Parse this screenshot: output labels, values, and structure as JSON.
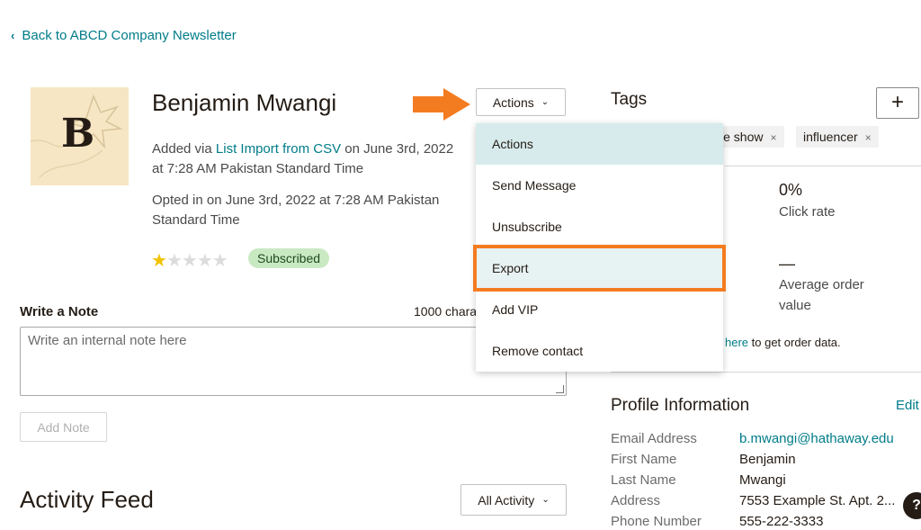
{
  "back_link": "Back to ABCD Company Newsletter",
  "avatar_letter": "B",
  "contact": {
    "name": "Benjamin Mwangi",
    "added_prefix": "Added via ",
    "added_link": "List Import from CSV",
    "added_suffix": " on June 3rd, 2022 at 7:28 AM Pakistan Standard Time",
    "opted_in": "Opted in on June 3rd, 2022 at 7:28 AM Pakistan Standard Time",
    "rating": 1,
    "rating_max": 5,
    "status": "Subscribed"
  },
  "actions_button": "Actions",
  "actions_menu": [
    "Actions",
    "Send Message",
    "Unsubscribe",
    "Export",
    "Add VIP",
    "Remove contact"
  ],
  "note": {
    "label": "Write a Note",
    "counter": "1000 characters",
    "placeholder": "Write an internal note here",
    "add_button": "Add Note"
  },
  "feed": {
    "title": "Activity Feed",
    "filter": "All Activity"
  },
  "tags": {
    "title": "Tags",
    "add": "+",
    "items": [
      "trade show",
      "influencer"
    ]
  },
  "stats": {
    "click_rate_value": "0%",
    "click_rate_label": "Click rate",
    "aov_value": "—",
    "aov_label": "Average order value",
    "orders_link": "here",
    "orders_text": " to get order data."
  },
  "profile": {
    "title": "Profile Information",
    "edit": "Edit",
    "fields": [
      {
        "key": "Email Address",
        "value": "b.mwangi@hathaway.edu"
      },
      {
        "key": "First Name",
        "value": "Benjamin"
      },
      {
        "key": "Last Name",
        "value": "Mwangi"
      },
      {
        "key": "Address",
        "value": "7553 Example St. Apt. 2..."
      },
      {
        "key": "Phone Number",
        "value": "555-222-3333"
      }
    ]
  },
  "colors": {
    "link": "#007c89",
    "highlight": "#f47c20",
    "badge_bg": "#c9e9c3",
    "star": "#f2c200"
  }
}
